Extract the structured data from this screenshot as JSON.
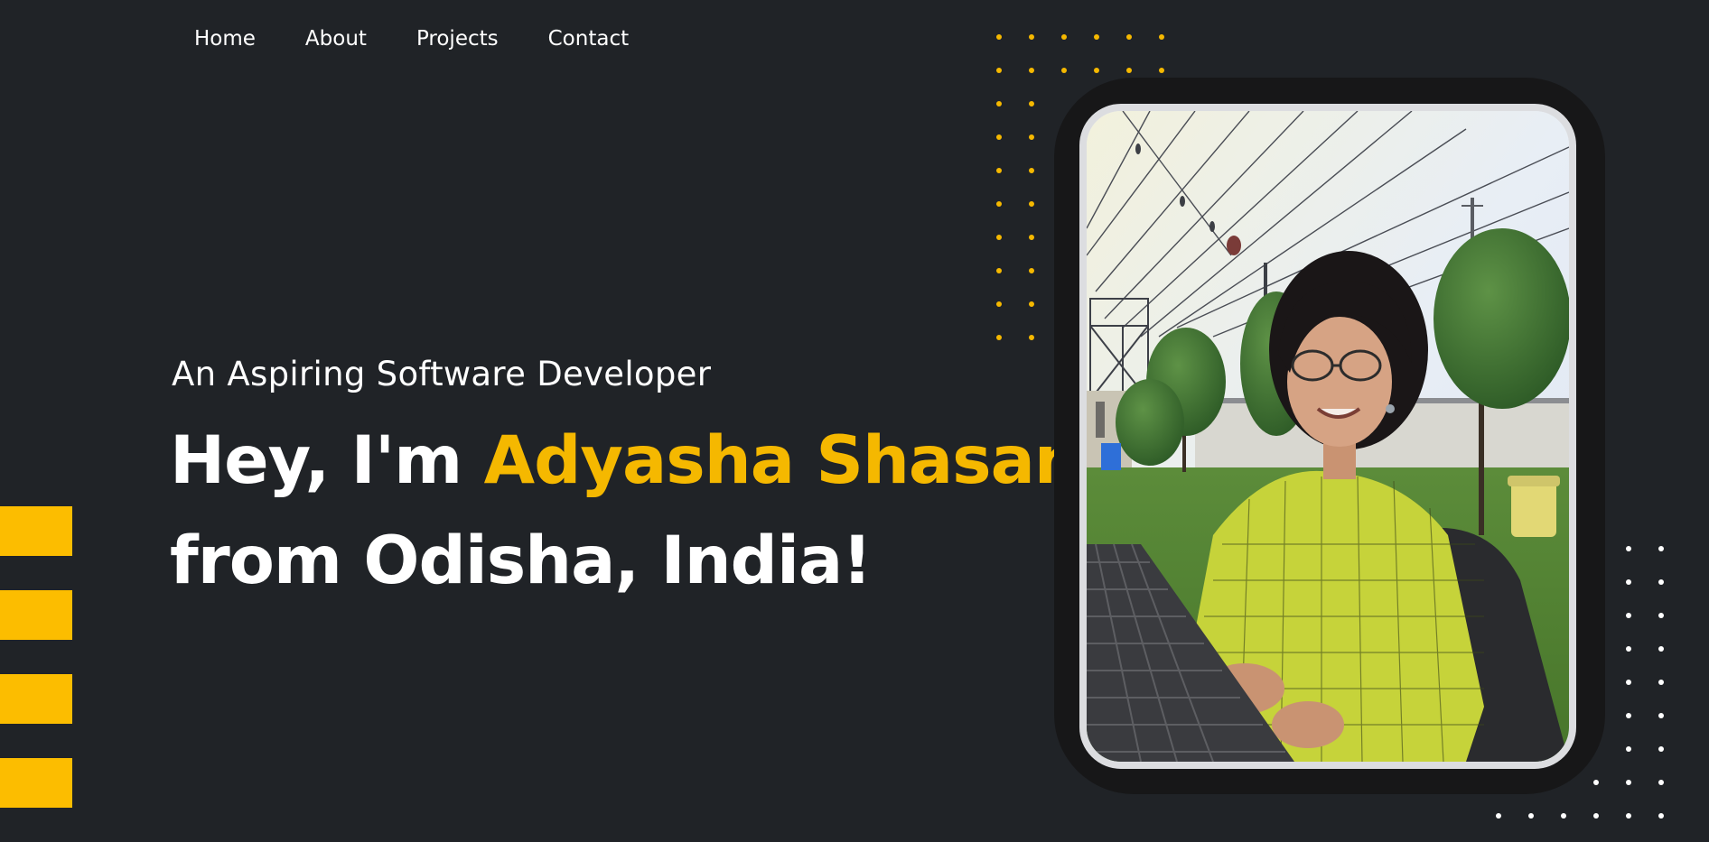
{
  "nav": {
    "items": [
      {
        "label": "Home"
      },
      {
        "label": "About"
      },
      {
        "label": "Projects"
      },
      {
        "label": "Contact"
      }
    ]
  },
  "hero": {
    "subtitle": "An Aspiring Software Developer",
    "greeting": "Hey, I'm ",
    "name": "Adyasha Shasani",
    "location_line": "from Odisha, India!"
  },
  "colors": {
    "background": "#202327",
    "accent": "#f5b800",
    "text": "#ffffff"
  },
  "decorations": {
    "icons": [
      "yellow-dot-grid",
      "white-dot-grid",
      "yellow-bar-stack"
    ]
  }
}
